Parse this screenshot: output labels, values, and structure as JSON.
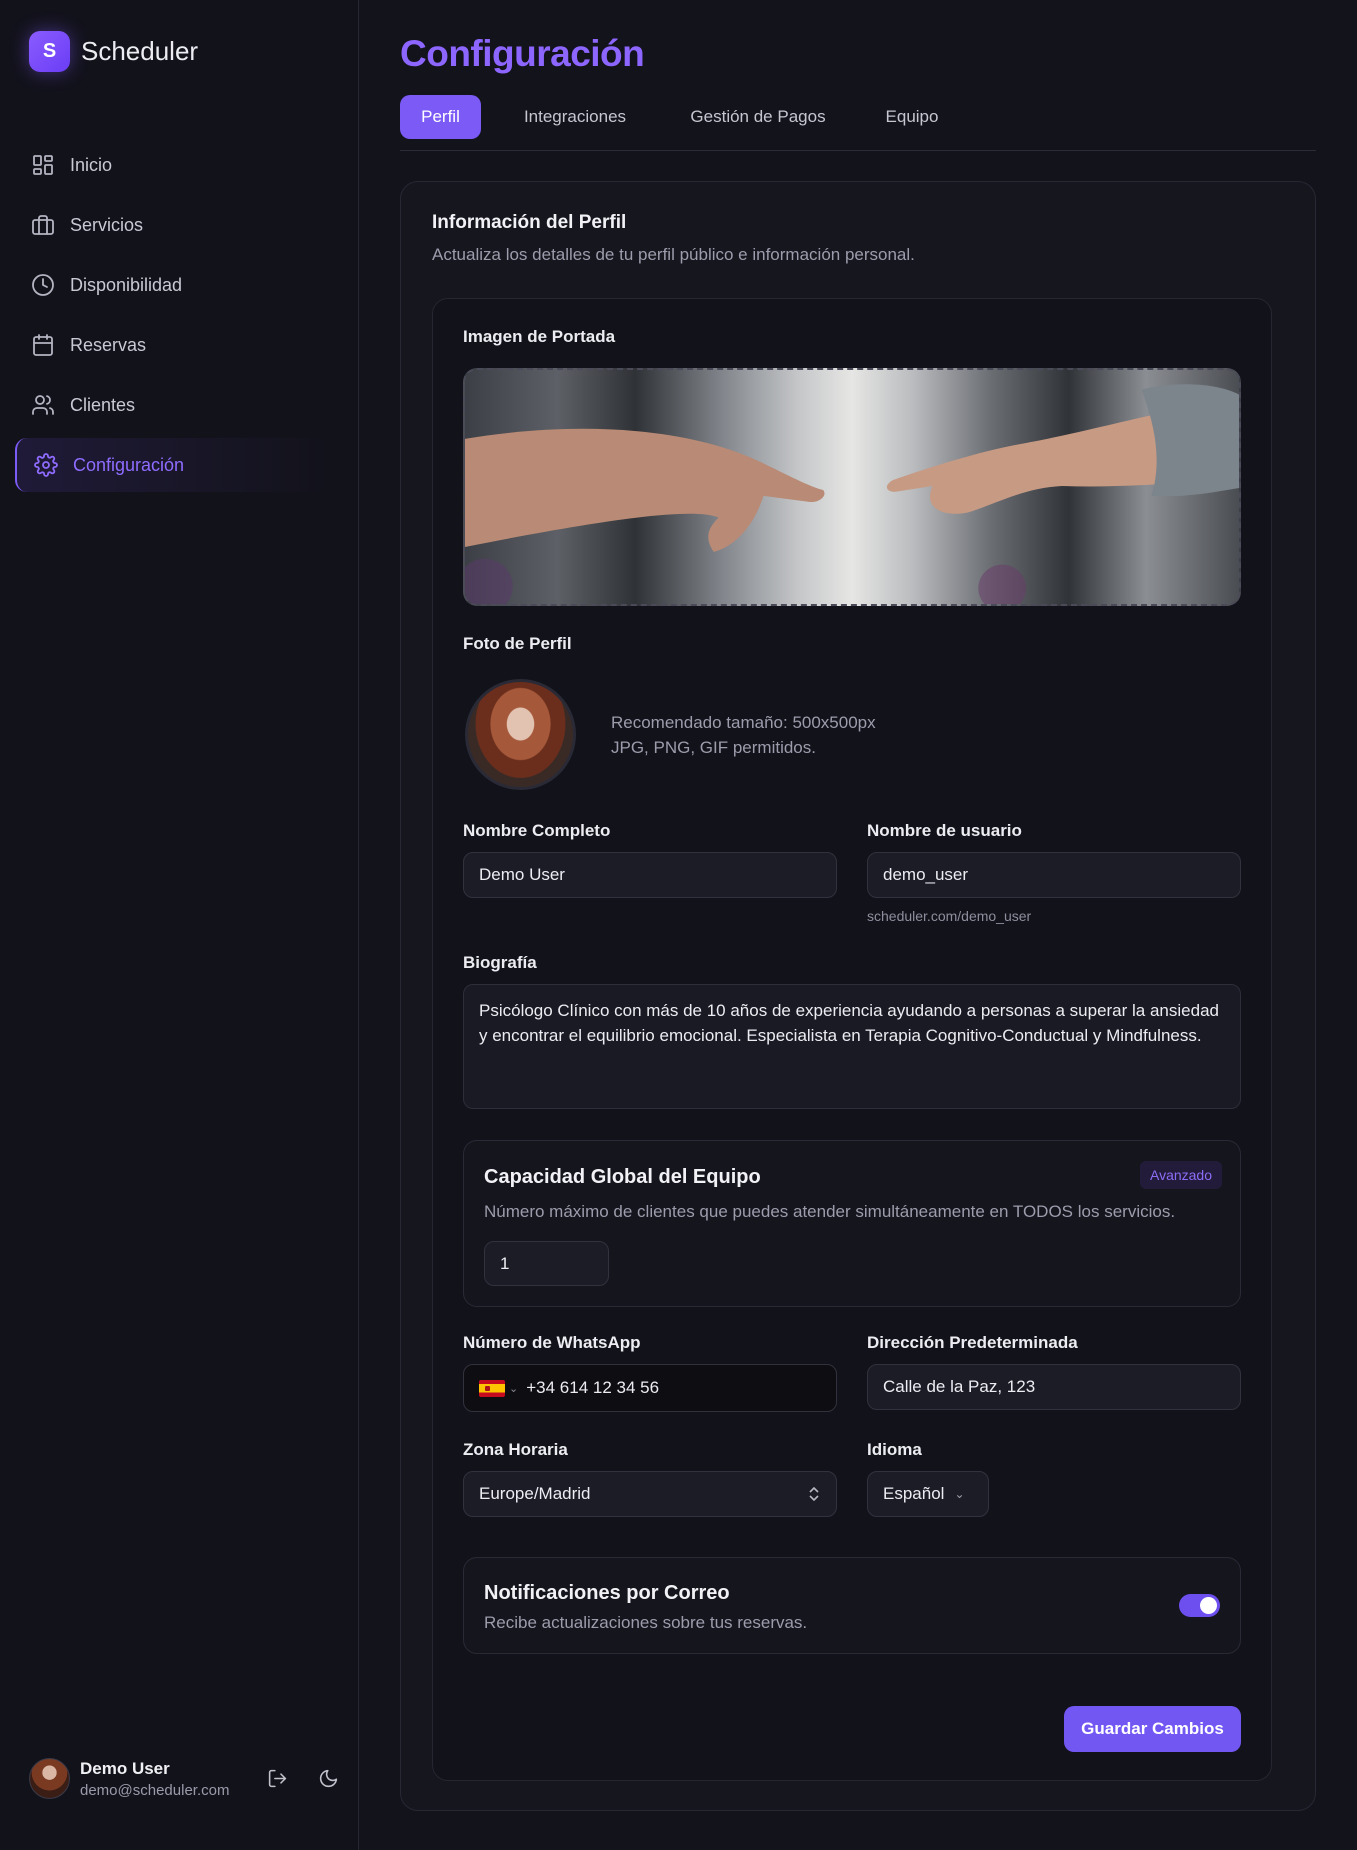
{
  "app": {
    "logo_letter": "S",
    "name": "Scheduler"
  },
  "sidebar": {
    "items": [
      {
        "label": "Inicio",
        "icon": "dashboard-icon"
      },
      {
        "label": "Servicios",
        "icon": "briefcase-icon"
      },
      {
        "label": "Disponibilidad",
        "icon": "clock-icon"
      },
      {
        "label": "Reservas",
        "icon": "calendar-icon"
      },
      {
        "label": "Clientes",
        "icon": "users-icon"
      },
      {
        "label": "Configuración",
        "icon": "gear-icon",
        "active": true
      }
    ],
    "user": {
      "name": "Demo User",
      "email": "demo@scheduler.com"
    }
  },
  "page": {
    "title": "Configuración"
  },
  "tabs": [
    {
      "label": "Perfil",
      "active": true
    },
    {
      "label": "Integraciones"
    },
    {
      "label": "Gestión de Pagos"
    },
    {
      "label": "Equipo"
    }
  ],
  "profile": {
    "title": "Información del Perfil",
    "subtitle": "Actualiza los detalles de tu perfil público e información personal.",
    "cover_label": "Imagen de Portada",
    "photo_label": "Foto de Perfil",
    "photo_hint_1": "Recomendado tamaño: 500x500px",
    "photo_hint_2": "JPG, PNG, GIF permitidos.",
    "full_name": {
      "label": "Nombre Completo",
      "value": "Demo User"
    },
    "username": {
      "label": "Nombre de usuario",
      "value": "demo_user",
      "hint": "scheduler.com/demo_user"
    },
    "bio": {
      "label": "Biografía",
      "value": "Psicólogo Clínico con más de 10 años de experiencia ayudando a personas a superar la ansiedad y encontrar el equilibrio emocional. Especialista en Terapia Cognitivo-Conductual y Mindfulness."
    },
    "capacity": {
      "title": "Capacidad Global del Equipo",
      "badge": "Avanzado",
      "description": "Número máximo de clientes que puedes atender simultáneamente en TODOS los servicios.",
      "value": "1"
    },
    "whatsapp": {
      "label": "Número de WhatsApp",
      "value": "+34 614 12 34 56",
      "flag": "spain-flag-icon"
    },
    "address": {
      "label": "Dirección Predeterminada",
      "value": "Calle de la Paz, 123"
    },
    "timezone": {
      "label": "Zona Horaria",
      "value": "Europe/Madrid"
    },
    "language": {
      "label": "Idioma",
      "value": "Español"
    },
    "notifications": {
      "title": "Notificaciones por Correo",
      "description": "Recibe actualizaciones sobre tus reservas.",
      "enabled": true
    },
    "save_label": "Guardar Cambios"
  },
  "colors": {
    "accent": "#7b5af5",
    "title": "#8d66ff",
    "background": "#13131c"
  }
}
